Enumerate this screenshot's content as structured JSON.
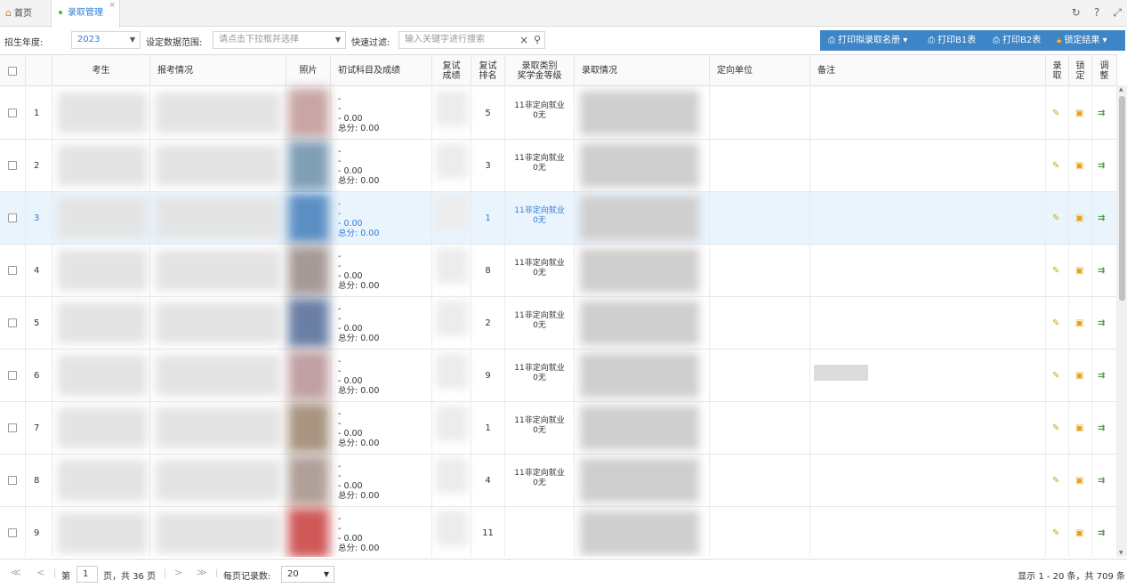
{
  "tabs": {
    "home": "首页",
    "active": "录取管理",
    "close": "×"
  },
  "top_icons": [
    "refresh-icon",
    "help-icon",
    "expand-icon"
  ],
  "toolbar": {
    "year_label": "招生年度:",
    "year_value": "2023",
    "range_label": "设定数据范围:",
    "range_placeholder": "请点击下拉框并选择",
    "filter_label": "快速过滤:",
    "filter_placeholder": "输入关键字进行搜索",
    "btn_print_list": "打印拟录取名册",
    "btn_print_b1": "打印B1表",
    "btn_print_b2": "打印B2表",
    "btn_lock": "锁定结果"
  },
  "columns": {
    "student": "考生",
    "apply": "报考情况",
    "photo": "照片",
    "initial": "初试科目及成绩",
    "retest_score": [
      "复试",
      "成绩"
    ],
    "retest_rank": [
      "复试",
      "排名"
    ],
    "category": [
      "录取类别",
      "奖学金等级"
    ],
    "admission": "录取情况",
    "unit": "定向单位",
    "note": "备注",
    "admit": [
      "录",
      "取"
    ],
    "lock": [
      "锁",
      "定"
    ],
    "adjust": [
      "调",
      "整"
    ]
  },
  "rows": [
    {
      "num": "1",
      "dash1": "-",
      "dash2": "-",
      "score": "- 0.00",
      "total": "总分:  0.00",
      "rank": "5",
      "cat1": "11非定向就业",
      "cat2": "0无",
      "selected": false
    },
    {
      "num": "2",
      "dash1": "-",
      "dash2": "-",
      "score": "- 0.00",
      "total": "总分:  0.00",
      "rank": "3",
      "cat1": "11非定向就业",
      "cat2": "0无",
      "selected": false
    },
    {
      "num": "3",
      "dash1": "-",
      "dash2": "-",
      "score": "- 0.00",
      "total": "总分:  0.00",
      "rank": "1",
      "cat1": "11非定向就业",
      "cat2": "0无",
      "selected": true
    },
    {
      "num": "4",
      "dash1": "-",
      "dash2": "-",
      "score": "- 0.00",
      "total": "总分:  0.00",
      "rank": "8",
      "cat1": "11非定向就业",
      "cat2": "0无",
      "selected": false
    },
    {
      "num": "5",
      "dash1": "-",
      "dash2": "-",
      "score": "- 0.00",
      "total": "总分:  0.00",
      "rank": "2",
      "cat1": "11非定向就业",
      "cat2": "0无",
      "selected": false
    },
    {
      "num": "6",
      "dash1": "-",
      "dash2": "-",
      "score": "- 0.00",
      "total": "总分:  0.00",
      "rank": "9",
      "cat1": "11非定向就业",
      "cat2": "0无",
      "selected": false
    },
    {
      "num": "7",
      "dash1": "-",
      "dash2": "-",
      "score": "- 0.00",
      "total": "总分:  0.00",
      "rank": "1",
      "cat1": "11非定向就业",
      "cat2": "0无",
      "selected": false
    },
    {
      "num": "8",
      "dash1": "-",
      "dash2": "-",
      "score": "- 0.00",
      "total": "总分:  0.00",
      "rank": "4",
      "cat1": "11非定向就业",
      "cat2": "0无",
      "selected": false
    },
    {
      "num": "9",
      "dash1": "-",
      "dash2": "-",
      "score": "- 0.00",
      "total": "总分:  0.00",
      "rank": "11",
      "cat1": "",
      "cat2": "",
      "selected": false
    }
  ],
  "photo_colors": [
    "#c9a5a5",
    "#7f9fb6",
    "#5b8fc4",
    "#a69a96",
    "#6b7fa6",
    "#c2a0a3",
    "#a89480",
    "#b0a098",
    "#d05858"
  ],
  "pager": {
    "first": "≪",
    "prev": "<",
    "page_prefix": "第",
    "page": "1",
    "page_suffix": "页，共 36 页",
    "next": ">",
    "last": "≫",
    "per_page_label": "每页记录数:",
    "per_page": "20",
    "info": "显示 1 - 20 条，共 709 条"
  }
}
